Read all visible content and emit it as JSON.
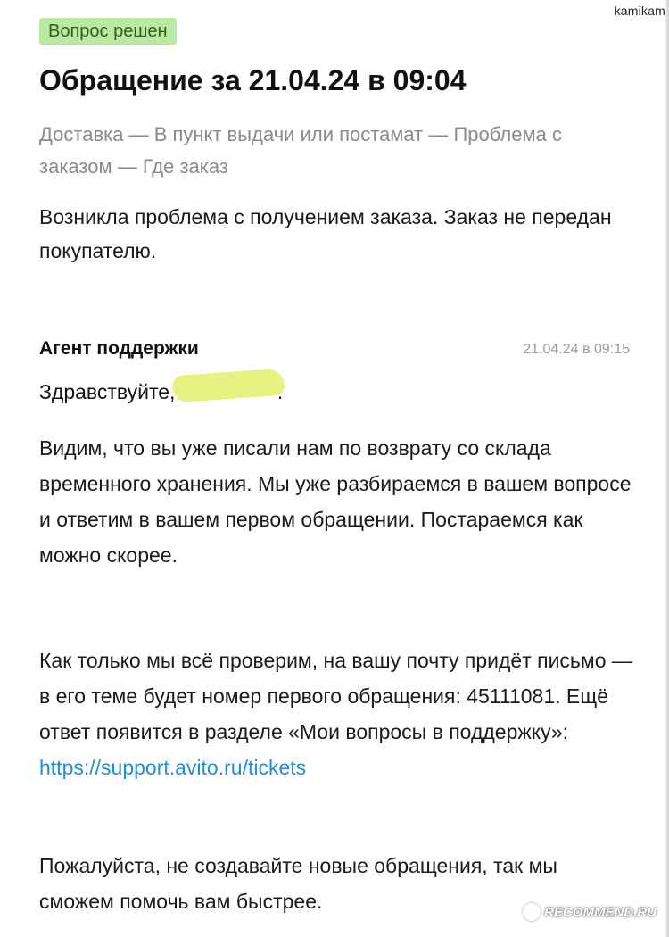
{
  "watermark_top": "kamikam",
  "status_badge": "Вопрос решен",
  "title": "Обращение за 21.04.24 в 09:04",
  "breadcrumb": "Доставка — В пункт выдачи или постамат — Проблема с заказом — Где заказ",
  "issue_text": "Возникла проблема с получением заказа. Заказ не передан покупателю.",
  "reply": {
    "agent": "Агент поддержки",
    "time": "21.04.24 в 09:15",
    "greeting_start": "Здравствуйте,",
    "greeting_end": ".",
    "paragraph1": "Видим, что вы уже писали нам по возврату со склада временного хранения. Мы уже разбираемся в вашем вопросе и ответим в вашем первом обращении. Постараемся как можно скорее.",
    "paragraph2": "Как только мы всё проверим, на вашу почту придёт письмо — в его теме будет номер первого обращения: 45111081. Ещё ответ появится в разделе «Мои вопросы в поддержку»: ",
    "link_text": "https://support.avito.ru/tickets",
    "paragraph3": "Пожалуйста, не создавайте новые обращения, так мы сможем помочь вам быстрее."
  },
  "watermark_bottom": "RECOMMEND.RU",
  "colors": {
    "badge_bg": "#b8eaa0",
    "badge_text": "#2f5d24",
    "link": "#1e8fd8",
    "muted": "#8a8a8a",
    "redaction": "#e6f27a"
  }
}
